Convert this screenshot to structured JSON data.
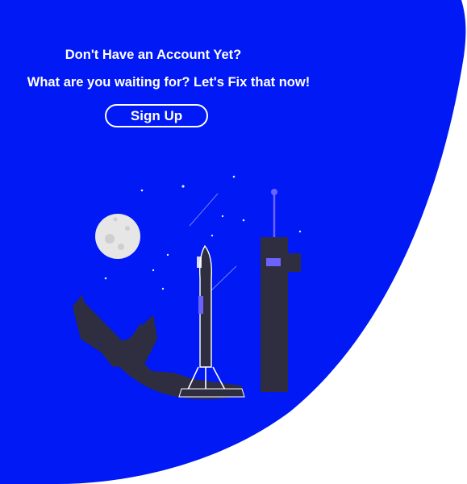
{
  "panel": {
    "heading": "Don't Have an Account Yet?",
    "subheading": "What are you waiting for? Let's Fix that now!",
    "signup_label": "Sign Up"
  },
  "colors": {
    "panel_background": "#0019f5",
    "text": "#ffffff",
    "illustration_dark": "#2f2e41",
    "illustration_accent": "#6c63ff",
    "moon": "#e6e6e6",
    "page_background": "#ffffff"
  },
  "illustration": {
    "name": "rocket-launch-illustration"
  }
}
